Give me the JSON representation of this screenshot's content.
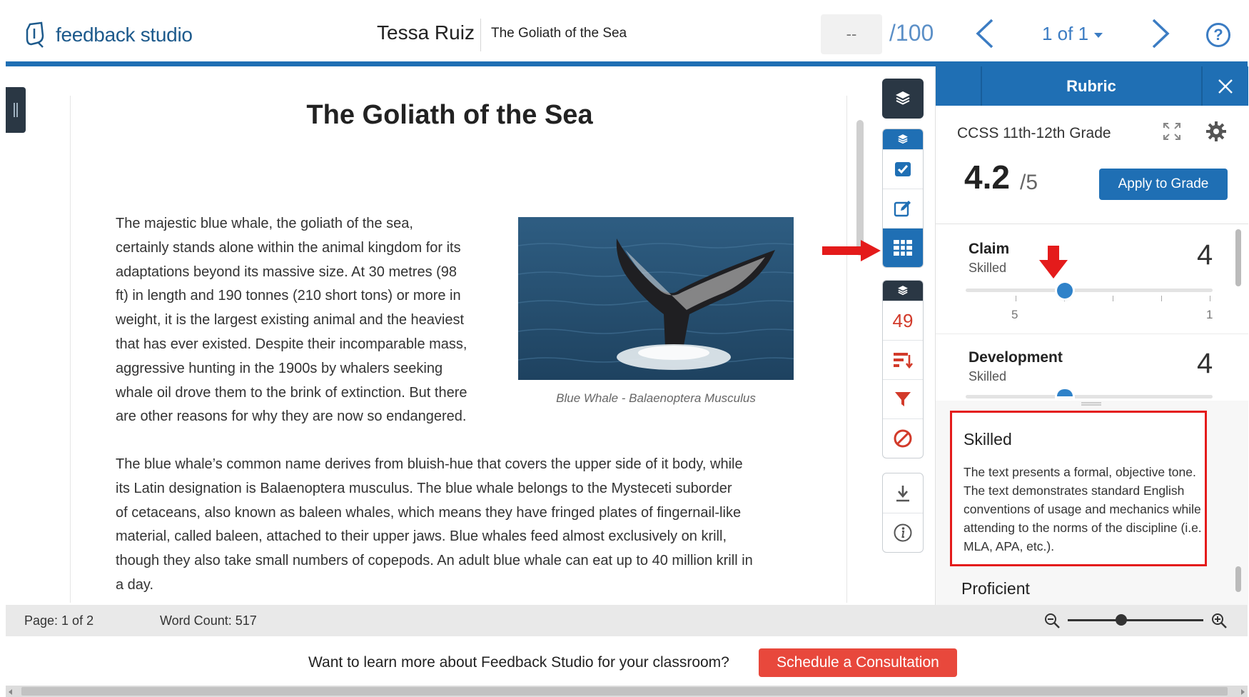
{
  "header": {
    "app_name": "feedback studio",
    "student_name": "Tessa Ruiz",
    "paper_title": "The Goliath of the Sea",
    "grade_value": "--",
    "grade_max": "/100",
    "page_selector": "1 of 1",
    "help_symbol": "?"
  },
  "document": {
    "title": "The Goliath of the Sea",
    "paragraph_1_lines": [
      "The majestic blue whale, the goliath of the sea,",
      "certainly stands alone within the animal kingdom for its",
      "adaptations beyond its massive size. At 30 metres (98",
      "ft) in length and 190 tonnes (210 short tons) or more in",
      "weight, it is the largest existing animal and the heaviest",
      "that has ever existed. Despite their incomparable mass,",
      "aggressive hunting in the 1900s by whalers seeking",
      "whale oil drove them to the brink of extinction. But there",
      "are other reasons for why they are now so endangered."
    ],
    "image_caption": "Blue Whale - Balaenoptera Musculus",
    "paragraph_2_lines": [
      "The blue whale’s common name derives from bluish-hue that covers the upper side of it body, while",
      "its Latin designation is Balaenoptera musculus. The blue whale belongs to the Mysteceti suborder",
      "of cetaceans, also known as baleen whales, which means they have fringed plates of fingernail-like",
      "material, called baleen, attached to their upper jaws. Blue whales feed almost exclusively on krill,",
      "though they also take small numbers of copepods. An adult blue whale can eat up to 40 million krill in",
      "a day."
    ]
  },
  "tools": {
    "instructor_layer_icons": [
      "check-square-icon",
      "edit-icon",
      "grid-icon"
    ],
    "similarity_count": "49",
    "similarity_icons": [
      "sort-icon",
      "filter-icon",
      "exclude-icon"
    ],
    "other_icons": [
      "download-icon",
      "info-icon"
    ]
  },
  "rubric": {
    "title": "Rubric",
    "name": "CCSS 11th-12th Grade",
    "score": "4.2",
    "score_max": "/5",
    "apply_label": "Apply to Grade",
    "criteria": [
      {
        "name": "Claim",
        "level": "Skilled",
        "score": "4",
        "scale_left": "5",
        "scale_right": "1"
      },
      {
        "name": "Development",
        "level": "Skilled",
        "score": "4"
      }
    ],
    "description": {
      "title": "Skilled",
      "text": "The text presents a formal, objective tone. The text demonstrates standard English conventions of usage and mechanics while attending to the norms of the discipline (i.e. MLA, APA, etc.).",
      "next_level_title": "Proficient"
    }
  },
  "status": {
    "page": "Page: 1 of 2",
    "word_count": "Word Count: 517"
  },
  "promo": {
    "text": "Want to learn more about Feedback Studio for your classroom?",
    "button": "Schedule a Consultation"
  },
  "colors": {
    "brand_blue": "#1f6fb4",
    "dark_toolbar": "#2a3744",
    "similarity_red": "#d23a2a",
    "highlight_red": "#e41b1b",
    "promo_button": "#e8483c"
  }
}
